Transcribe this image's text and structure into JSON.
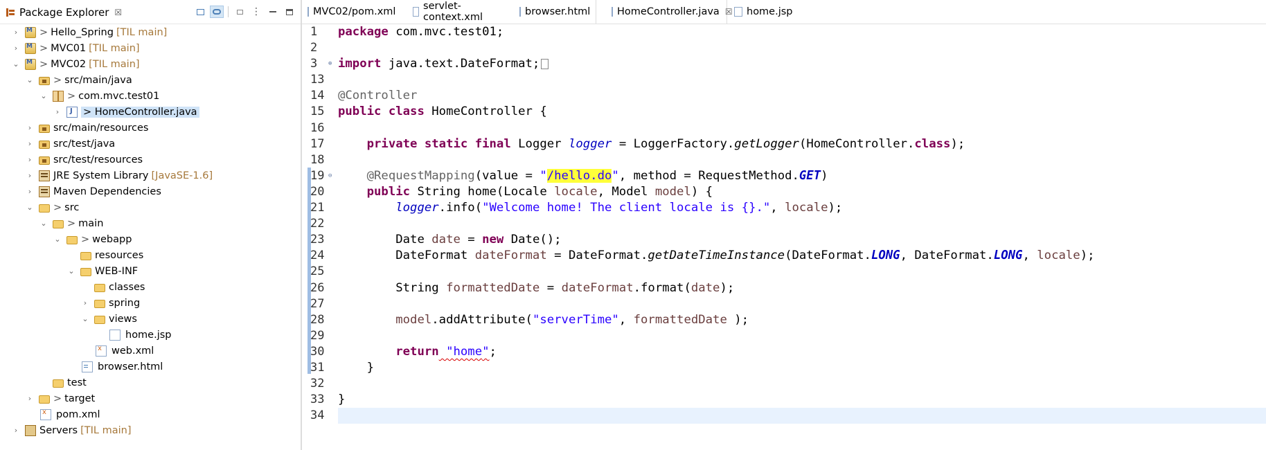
{
  "explorer": {
    "title": "Package Explorer",
    "close_glyph": "☒",
    "tree": [
      {
        "label": "Hello_Spring",
        "prefix": ">",
        "decoration": "[TIL main]",
        "toggle": "›",
        "icon": "maven-project-icon"
      },
      {
        "label": "MVC01",
        "prefix": ">",
        "decoration": "[TIL main]",
        "toggle": "›",
        "icon": "maven-project-icon"
      },
      {
        "label": "MVC02",
        "prefix": ">",
        "decoration": "[TIL main]",
        "toggle": "⌄",
        "icon": "maven-project-icon"
      },
      {
        "label": "src/main/java",
        "prefix": ">",
        "decoration": "",
        "toggle": "⌄",
        "icon": "source-folder-icon"
      },
      {
        "label": "com.mvc.test01",
        "prefix": ">",
        "decoration": "",
        "toggle": "⌄",
        "icon": "package-icon"
      },
      {
        "label": "HomeController.java",
        "prefix": ">",
        "decoration": "",
        "toggle": "›",
        "icon": "java-file-icon",
        "selected": true
      },
      {
        "label": "src/main/resources",
        "prefix": "",
        "decoration": "",
        "toggle": "›",
        "icon": "source-folder-icon"
      },
      {
        "label": "src/test/java",
        "prefix": "",
        "decoration": "",
        "toggle": "›",
        "icon": "source-folder-icon"
      },
      {
        "label": "src/test/resources",
        "prefix": "",
        "decoration": "",
        "toggle": "›",
        "icon": "source-folder-icon"
      },
      {
        "label": "JRE System Library",
        "prefix": "",
        "decoration": "[JavaSE-1.6]",
        "toggle": "›",
        "icon": "library-icon"
      },
      {
        "label": "Maven Dependencies",
        "prefix": "",
        "decoration": "",
        "toggle": "›",
        "icon": "library-icon"
      },
      {
        "label": "src",
        "prefix": ">",
        "decoration": "",
        "toggle": "⌄",
        "icon": "folder-icon"
      },
      {
        "label": "main",
        "prefix": ">",
        "decoration": "",
        "toggle": "⌄",
        "icon": "folder-icon"
      },
      {
        "label": "webapp",
        "prefix": ">",
        "decoration": "",
        "toggle": "⌄",
        "icon": "folder-icon"
      },
      {
        "label": "resources",
        "prefix": "",
        "decoration": "",
        "toggle": "",
        "icon": "folder-icon"
      },
      {
        "label": "WEB-INF",
        "prefix": "",
        "decoration": "",
        "toggle": "⌄",
        "icon": "folder-icon"
      },
      {
        "label": "classes",
        "prefix": "",
        "decoration": "",
        "toggle": "",
        "icon": "folder-icon"
      },
      {
        "label": "spring",
        "prefix": "",
        "decoration": "",
        "toggle": "›",
        "icon": "folder-icon"
      },
      {
        "label": "views",
        "prefix": "",
        "decoration": "",
        "toggle": "⌄",
        "icon": "folder-icon"
      },
      {
        "label": "home.jsp",
        "prefix": "",
        "decoration": "",
        "toggle": "",
        "icon": "jsp-file-icon"
      },
      {
        "label": "web.xml",
        "prefix": "",
        "decoration": "",
        "toggle": "",
        "icon": "xml-file-icon"
      },
      {
        "label": "browser.html",
        "prefix": "",
        "decoration": "",
        "toggle": "",
        "icon": "html-file-icon"
      },
      {
        "label": "test",
        "prefix": "",
        "decoration": "",
        "toggle": "",
        "icon": "folder-icon"
      },
      {
        "label": "target",
        "prefix": ">",
        "decoration": "",
        "toggle": "›",
        "icon": "folder-icon"
      },
      {
        "label": "pom.xml",
        "prefix": "",
        "decoration": "",
        "toggle": "",
        "icon": "maven-pom-icon"
      },
      {
        "label": "Servers",
        "prefix": "",
        "decoration": "[TIL main]",
        "toggle": "›",
        "icon": "server-folder-icon"
      }
    ]
  },
  "editor_tabs": [
    {
      "label": "MVC02/pom.xml",
      "icon": "maven-pom-icon"
    },
    {
      "label": "servlet-context.xml",
      "icon": "xml-file-icon"
    },
    {
      "label": "browser.html",
      "icon": "html-file-icon"
    },
    {
      "label": "HomeController.java",
      "icon": "java-file-icon",
      "active": true,
      "close": "☒"
    },
    {
      "label": "home.jsp",
      "icon": "jsp-file-icon"
    }
  ],
  "code": {
    "line_numbers": [
      "1",
      "2",
      "3",
      "13",
      "14",
      "15",
      "16",
      "17",
      "18",
      "19",
      "20",
      "21",
      "22",
      "23",
      "24",
      "25",
      "26",
      "27",
      "28",
      "29",
      "30",
      "31",
      "32",
      "33",
      "34"
    ],
    "t": {
      "package": "package",
      "package_name": " com.mvc.test01;",
      "import": "import",
      "import_name": " java.text.DateFormat;",
      "annotation_controller": "@Controller",
      "public": "public",
      "class": "class",
      "class_name": " HomeController {",
      "indent4": "    ",
      "indent8": "        ",
      "private": "private",
      "static": "static",
      "final": "final",
      "logger_type": " Logger ",
      "logger_field": "logger",
      "logger_init_a": " = LoggerFactory.",
      "getLogger": "getLogger",
      "logger_init_b": "(HomeController.",
      "class_kw": "class",
      "logger_init_c": ");",
      "annotation_rm": "@RequestMapping",
      "rm_a": "(value = ",
      "rm_str_q1": "\"",
      "rm_str_hl": "/hello.do",
      "rm_str_q2": "\"",
      "rm_b": ", method = RequestMethod.",
      "GET": "GET",
      "rm_c": ")",
      "string_type": " String home(Locale ",
      "locale": "locale",
      "model_type": ", Model ",
      "model": "model",
      "method_end": ") {",
      "info_a": ".info(",
      "info_str": "\"Welcome home! The client locale is {}.\"",
      "info_b": ", ",
      "info_c": ");",
      "date_type": "Date ",
      "date": "date",
      "date_eq": " = ",
      "new": "new",
      "date_ctor": " Date();",
      "df_type": "DateFormat ",
      "dateFormat": "dateFormat",
      "df_eq": " = DateFormat.",
      "getDTI": "getDateTimeInstance",
      "df_args_a": "(DateFormat.",
      "LONG": "LONG",
      "df_args_b": ", DateFormat.",
      "df_args_c": ", ",
      "df_args_d": ");",
      "fd_type": "String ",
      "formattedDate": "formattedDate",
      "fd_eq": " = ",
      "fd_call": ".format(",
      "fd_end": ");",
      "model_call": ".addAttribute(",
      "serverTime": "\"serverTime\"",
      "ma_sep": ", ",
      "ma_end": " );",
      "return": "return",
      "home_q1": " \"",
      "home": "home",
      "home_q2": "\"",
      "home_end": ";",
      "close_brace": "}"
    }
  }
}
